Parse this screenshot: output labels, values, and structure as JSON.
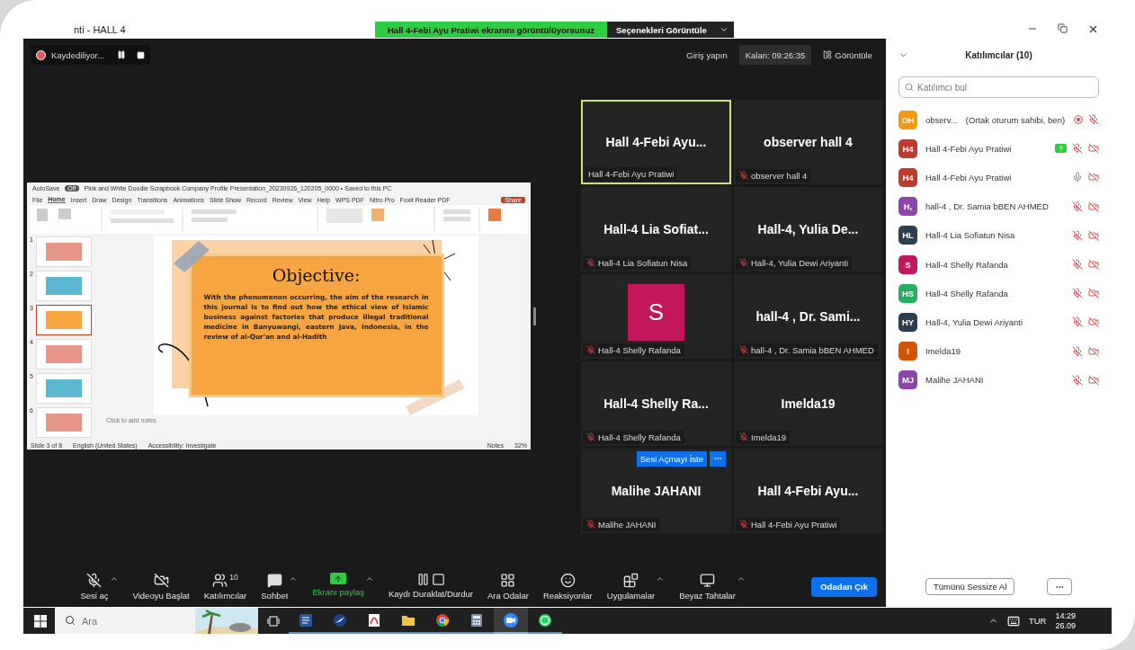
{
  "window": {
    "title": "nti - HALL 4"
  },
  "share_banner": {
    "text": "Hall 4-Febi Ayu Pratiwi ekranını görüntülüyorsunuz",
    "options": "Seçenekleri Görüntüle"
  },
  "recording": {
    "label": "Kaydediliyor...",
    "paused": false
  },
  "top_controls": {
    "signin": "Giriş yapın",
    "remaining": "Kalan: 09:26:35",
    "view": "Görüntüle"
  },
  "shared_screen": {
    "autosave": "AutoSave",
    "autosave_state": "Off",
    "title": "Pink and White Doodle Scrapbook Company Profile Presentation_20230926_120205_0000 • Saved to this PC",
    "share": "Share",
    "menu": [
      {
        "label": "File",
        "selected": false
      },
      {
        "label": "Home",
        "selected": true
      },
      {
        "label": "Insert",
        "selected": false
      },
      {
        "label": "Draw",
        "selected": false
      },
      {
        "label": "Design",
        "selected": false
      },
      {
        "label": "Transitions",
        "selected": false
      },
      {
        "label": "Animations",
        "selected": false
      },
      {
        "label": "Slide Show",
        "selected": false
      },
      {
        "label": "Record",
        "selected": false
      },
      {
        "label": "Review",
        "selected": false
      },
      {
        "label": "View",
        "selected": false
      },
      {
        "label": "Help",
        "selected": false
      },
      {
        "label": "WPS PDF",
        "selected": false
      },
      {
        "label": "Nitro Pro",
        "selected": false
      },
      {
        "label": "Foxit Reader PDF",
        "selected": false
      }
    ],
    "thumbnails": [
      {
        "number": "1",
        "selected": false,
        "color": "#e8968a"
      },
      {
        "number": "2",
        "selected": false,
        "color": "#5bb8d0"
      },
      {
        "number": "3",
        "selected": true,
        "color": "#f7a541"
      },
      {
        "number": "4",
        "selected": false,
        "color": "#e8968a"
      },
      {
        "number": "5",
        "selected": false,
        "color": "#5bb8d0"
      },
      {
        "number": "6",
        "selected": false,
        "color": "#e8968a"
      }
    ],
    "slide": {
      "heading": "Objective:",
      "body": "With the phenomenon occurring, the aim of the research in this journal is to find out how the ethical view of Islamic business against factories that produce illegal traditional medicine in Banyuwangi, eastern Java, Indonesia, in the review of al-Qur'an and al-Hadith"
    },
    "notes_placeholder": "Click to add notes",
    "status": {
      "slide": "Slide 3 of 8",
      "language": "English (United States)",
      "accessibility": "Accessibility: Investigate",
      "notes": "Notes",
      "zoom": "32%"
    }
  },
  "gallery": [
    {
      "title": "Hall 4-Febi Ayu...",
      "name": "Hall 4-Febi Ayu Pratiwi",
      "muted": false,
      "speaking": true
    },
    {
      "title": "observer hall 4",
      "name": "observer hall 4",
      "muted": true,
      "speaking": false
    },
    {
      "title": "Hall-4 Lia Sofiat...",
      "name": "Hall-4 Lia Sofiatun Nisa",
      "muted": true,
      "speaking": false
    },
    {
      "title": "Hall-4, Yulia De...",
      "name": "Hall-4, Yulia Dewi Ariyanti",
      "muted": true,
      "speaking": false
    },
    {
      "avatar": {
        "letter": "S",
        "color": "#c2185b"
      },
      "name": "Hall-4 Shelly Rafanda",
      "muted": true,
      "speaking": false
    },
    {
      "title": "hall-4 , Dr. Sami...",
      "name": "hall-4 , Dr. Samia bBEN AHMED",
      "muted": true,
      "speaking": false
    },
    {
      "title": "Hall-4 Shelly Ra...",
      "name": "Hall-4 Shelly Rafanda",
      "muted": true,
      "speaking": false
    },
    {
      "title": "Imelda19",
      "name": "Imelda19",
      "muted": true,
      "speaking": false
    },
    {
      "title": "Malihe JAHANI",
      "name": "Malihe JAHANI",
      "muted": true,
      "speaking": false,
      "request": "Sesi Açmayı İste"
    },
    {
      "title": "Hall 4-Febi Ayu...",
      "name": "Hall 4-Febi Ayu Pratiwi",
      "muted": true,
      "speaking": false
    }
  ],
  "toolbar": [
    {
      "kind": "mic",
      "label": "Sesi aç",
      "off": true,
      "menu": true
    },
    {
      "kind": "video",
      "label": "Videoyu Başlat",
      "off": true,
      "menu": false
    },
    {
      "kind": "participants",
      "label": "Katılımcılar",
      "count": "10",
      "menu": false
    },
    {
      "kind": "chat",
      "label": "Sohbet",
      "menu": true
    },
    {
      "kind": "share",
      "label": "Ekranı paylaş",
      "menu": true
    },
    {
      "kind": "record",
      "label": "Kaydı Duraklat/Durdur",
      "menu": false
    },
    {
      "kind": "rooms",
      "label": "Ara Odalar",
      "menu": false
    },
    {
      "kind": "reactions",
      "label": "Reaksiyonlar",
      "menu": false
    },
    {
      "kind": "apps",
      "label": "Uygulamalar",
      "menu": true
    },
    {
      "kind": "whiteboard",
      "label": "Beyaz Tahtalar",
      "menu": true
    }
  ],
  "leave": "Odadan Çık",
  "participants_panel": {
    "title": "Katılımcılar (10)",
    "search": {
      "placeholder": "Katılımcı bul"
    },
    "items": [
      {
        "initials": "OH",
        "color": "#f29a12",
        "name": "observ...",
        "note": "(Ortak oturum sahibi, ben)",
        "recording": true,
        "sharing": false,
        "mic_muted": true,
        "video_off": false
      },
      {
        "initials": "H4",
        "color": "#c0392b",
        "name": "Hall 4-Febi Ayu Pratiwi",
        "recording": false,
        "sharing": true,
        "mic_muted": true,
        "video_off": true
      },
      {
        "initials": "H4",
        "color": "#c0392b",
        "name": "Hall 4-Febi Ayu Pratiwi",
        "recording": false,
        "sharing": false,
        "mic_muted": false,
        "video_off": true
      },
      {
        "initials": "H,",
        "color": "#8e44ad",
        "name": "hall-4 , Dr. Samia bBEN AHMED",
        "recording": false,
        "sharing": false,
        "mic_muted": true,
        "video_off": true
      },
      {
        "initials": "HL",
        "color": "#2c3e50",
        "name": "Hall-4 Lia Sofiatun Nisa",
        "recording": false,
        "sharing": false,
        "mic_muted": true,
        "video_off": true
      },
      {
        "initials": "S",
        "color": "#c2185b",
        "name": "Hall-4 Shelly Rafanda",
        "recording": false,
        "sharing": false,
        "mic_muted": true,
        "video_off": true
      },
      {
        "initials": "HS",
        "color": "#27ae60",
        "name": "Hall-4 Shelly Rafanda",
        "recording": false,
        "sharing": false,
        "mic_muted": true,
        "video_off": true
      },
      {
        "initials": "HY",
        "color": "#2c3e50",
        "name": "Hall-4, Yulia Dewi Ariyanti",
        "recording": false,
        "sharing": false,
        "mic_muted": true,
        "video_off": true
      },
      {
        "initials": "I",
        "color": "#d35400",
        "name": "Imelda19",
        "recording": false,
        "sharing": false,
        "mic_muted": true,
        "video_off": true
      },
      {
        "initials": "MJ",
        "color": "#8e44ad",
        "name": "Malihe JAHANI",
        "recording": false,
        "sharing": false,
        "mic_muted": true,
        "video_off": true
      }
    ],
    "mute_all": "Tümünü Sessize Al"
  },
  "taskbar": {
    "search": {
      "placeholder": "Ara"
    },
    "apps": [
      {
        "kind": "word",
        "selected": false
      },
      {
        "kind": "browser",
        "selected": false
      },
      {
        "kind": "pdf",
        "selected": false
      },
      {
        "kind": "folder",
        "selected": false
      },
      {
        "kind": "chrome",
        "selected": false
      },
      {
        "kind": "calculator",
        "selected": false
      },
      {
        "kind": "zoom",
        "selected": true
      },
      {
        "kind": "whatsapp",
        "selected": false
      }
    ],
    "language": "TUR",
    "time": "14:29",
    "date": "26.09"
  }
}
